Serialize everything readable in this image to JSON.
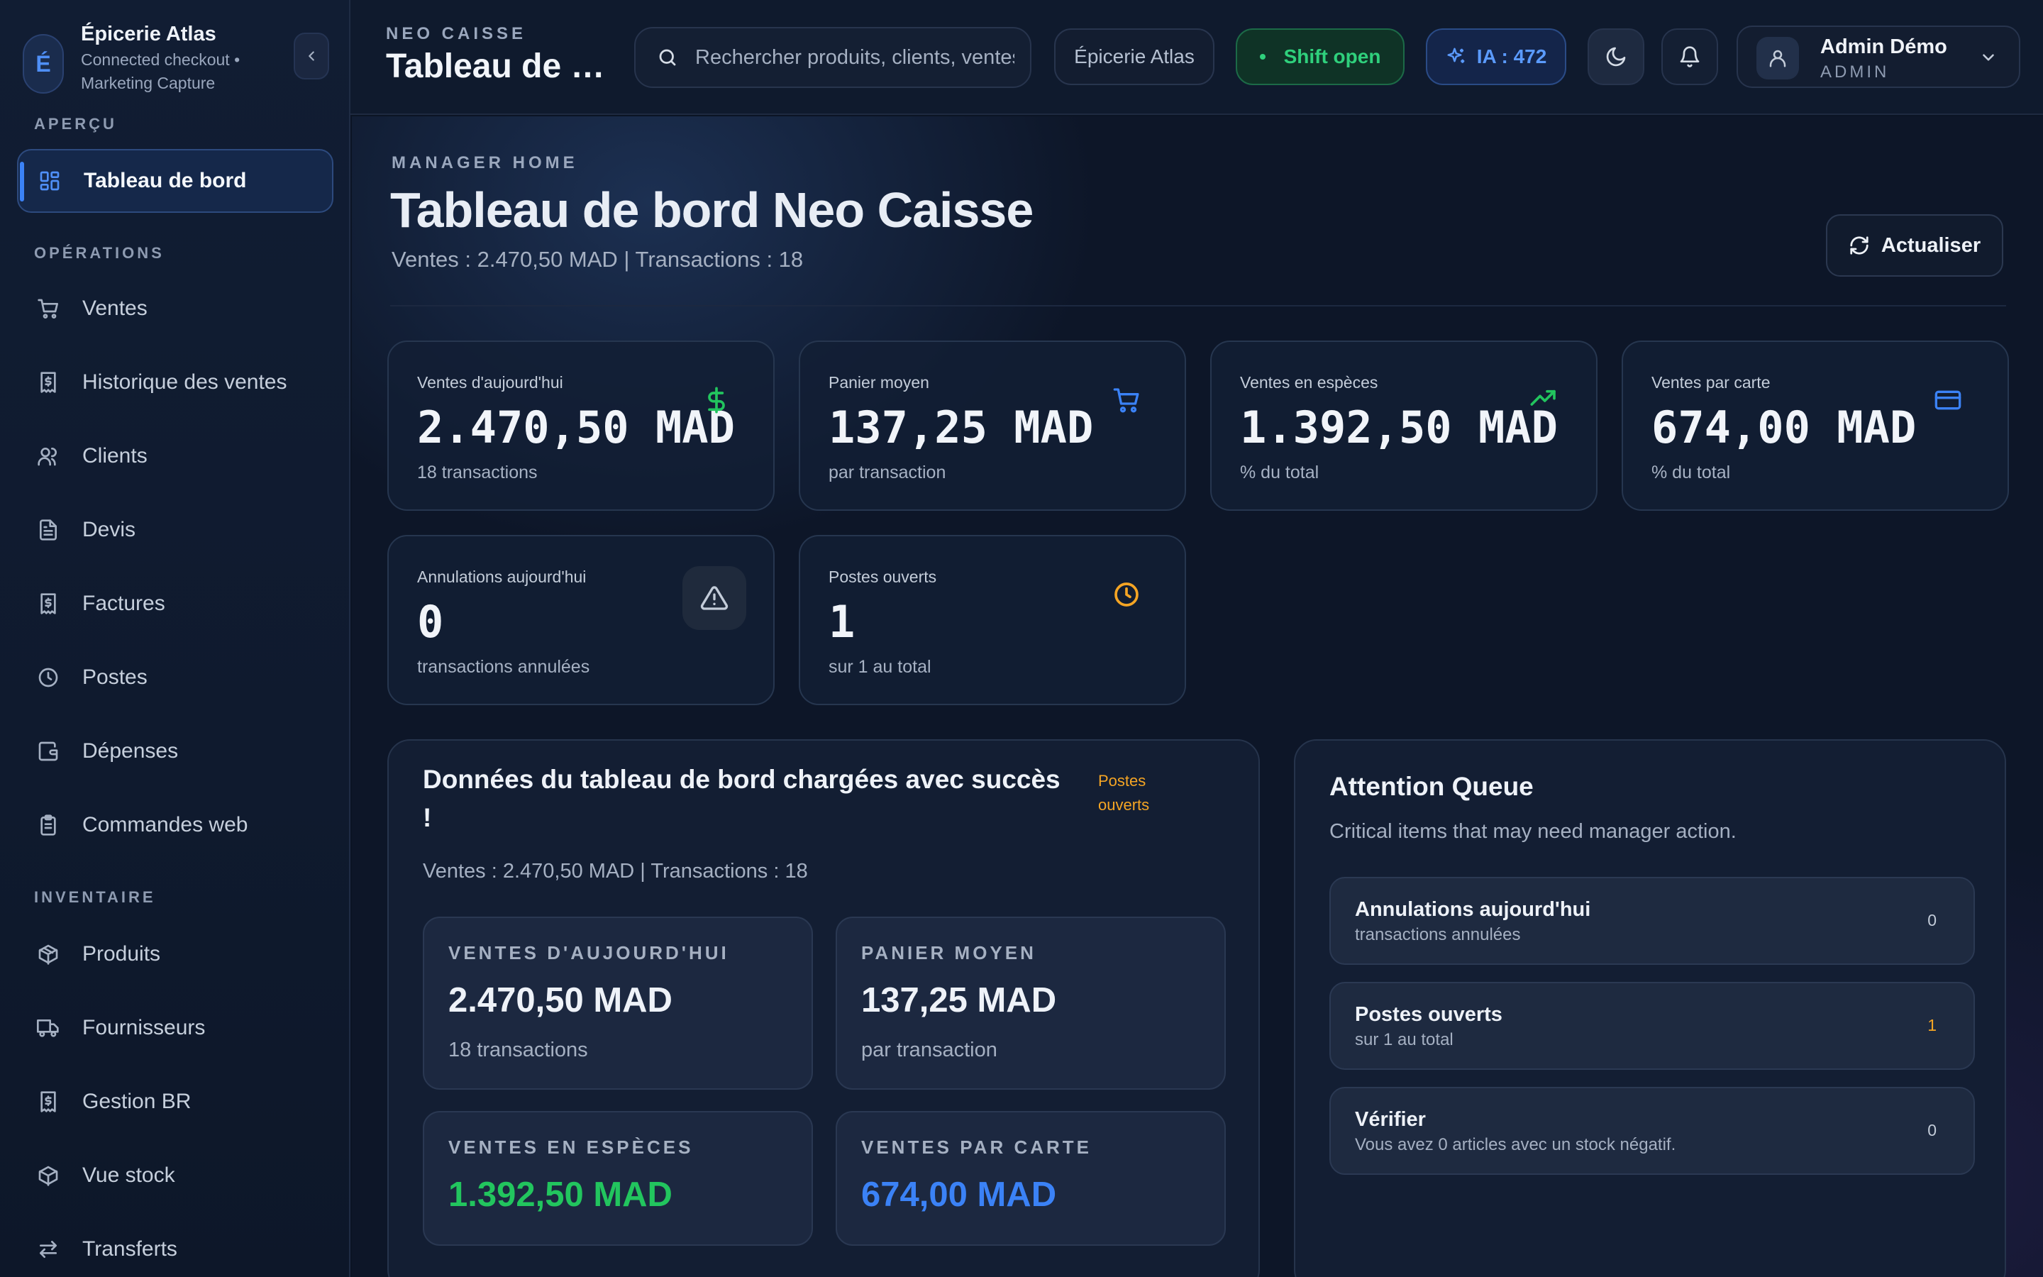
{
  "brand": {
    "initial": "É",
    "name": "Épicerie Atlas",
    "subtitle": "Connected checkout • Marketing Capture"
  },
  "sidebar": {
    "sections": [
      {
        "title": "APERÇU"
      },
      {
        "title": "OPÉRATIONS"
      },
      {
        "title": "INVENTAIRE"
      }
    ],
    "items": [
      {
        "label": "Tableau de bord",
        "icon": "dashboard-icon",
        "active": true
      },
      {
        "label": "Ventes",
        "icon": "cart-icon"
      },
      {
        "label": "Historique des ventes",
        "icon": "receipt-icon"
      },
      {
        "label": "Clients",
        "icon": "users-icon"
      },
      {
        "label": "Devis",
        "icon": "document-icon"
      },
      {
        "label": "Factures",
        "icon": "invoice-icon"
      },
      {
        "label": "Postes",
        "icon": "clock-icon"
      },
      {
        "label": "Dépenses",
        "icon": "wallet-icon"
      },
      {
        "label": "Commandes web",
        "icon": "clipboard-icon"
      },
      {
        "label": "Produits",
        "icon": "package-icon"
      },
      {
        "label": "Fournisseurs",
        "icon": "truck-icon"
      },
      {
        "label": "Gestion BR",
        "icon": "receipt-icon"
      },
      {
        "label": "Vue stock",
        "icon": "package-icon"
      },
      {
        "label": "Transferts",
        "icon": "transfer-icon"
      }
    ]
  },
  "topbar": {
    "eyebrow": "NEO CAISSE",
    "title": "Tableau de bord",
    "search_placeholder": "Rechercher produits, clients, ventes",
    "store": "Épicerie Atlas",
    "shift": "Shift open",
    "ia": "IA : 472",
    "user_name": "Admin Démo",
    "user_role": "ADMIN"
  },
  "header": {
    "eyebrow": "MANAGER HOME",
    "title": "Tableau de bord Neo Caisse",
    "subtitle": "Ventes : 2.470,50 MAD | Transactions : 18",
    "refresh": "Actualiser"
  },
  "stats": [
    {
      "label": "Ventes d'aujourd'hui",
      "value": "2.470,50 MAD",
      "sub": "18 transactions",
      "icon": "dollar-icon",
      "color": "#22c55e"
    },
    {
      "label": "Panier moyen",
      "value": "137,25 MAD",
      "sub": "par transaction",
      "icon": "cart-icon",
      "color": "#3b82f6"
    },
    {
      "label": "Ventes en espèces",
      "value": "1.392,50 MAD",
      "sub": "% du total",
      "icon": "trending-up-icon",
      "color": "#22c55e"
    },
    {
      "label": "Ventes par carte",
      "value": "674,00 MAD",
      "sub": "% du total",
      "icon": "credit-card-icon",
      "color": "#3b82f6"
    },
    {
      "label": "Annulations aujourd'hui",
      "value": "0",
      "sub": "transactions annulées",
      "icon": "warning-icon",
      "color": "#c3ccd9"
    },
    {
      "label": "Postes ouverts",
      "value": "1",
      "sub": "sur 1 au total",
      "icon": "clock-icon",
      "color": "#f5a524"
    }
  ],
  "summary": {
    "title": "Données du tableau de bord chargées avec succès !",
    "tag": "Postes ouverts",
    "subtitle": "Ventes : 2.470,50 MAD | Transactions : 18",
    "cards": [
      {
        "label": "VENTES D'AUJOURD'HUI",
        "value": "2.470,50 MAD",
        "sub": "18 transactions",
        "color": "#eef2f8"
      },
      {
        "label": "PANIER MOYEN",
        "value": "137,25 MAD",
        "sub": "par transaction",
        "color": "#eef2f8"
      },
      {
        "label": "VENTES EN ESPÈCES",
        "value": "1.392,50 MAD",
        "color": "#22c55e"
      },
      {
        "label": "VENTES PAR CARTE",
        "value": "674,00 MAD",
        "color": "#3b82f6"
      }
    ]
  },
  "queue": {
    "title": "Attention Queue",
    "subtitle": "Critical items that may need manager action.",
    "items": [
      {
        "title": "Annulations aujourd'hui",
        "sub": "transactions annulées",
        "count": "0",
        "color": "#c3ccd9"
      },
      {
        "title": "Postes ouverts",
        "sub": "sur 1 au total",
        "count": "1",
        "color": "#f5a524"
      },
      {
        "title": "Vérifier",
        "sub": "Vous avez 0 articles avec un stock négatif.",
        "count": "0",
        "color": "#c3ccd9"
      }
    ]
  }
}
